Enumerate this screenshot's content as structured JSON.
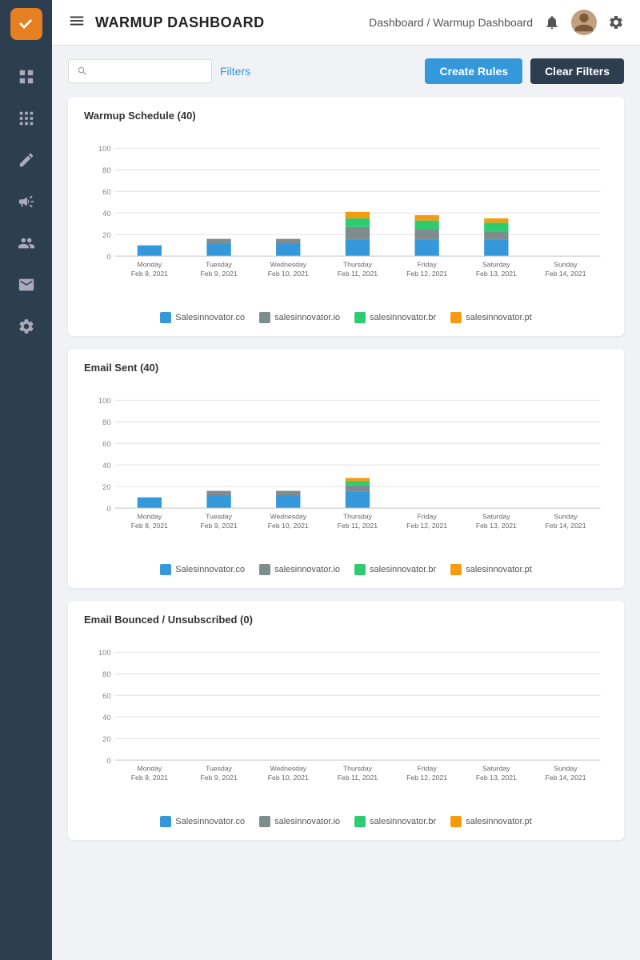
{
  "sidebar": {
    "logo_alt": "logo",
    "items": [
      {
        "name": "dashboard-icon",
        "label": "Dashboard"
      },
      {
        "name": "grid-icon",
        "label": "Grid"
      },
      {
        "name": "edit-icon",
        "label": "Edit"
      },
      {
        "name": "megaphone-icon",
        "label": "Campaigns"
      },
      {
        "name": "users-icon",
        "label": "Users"
      },
      {
        "name": "mail-icon",
        "label": "Mail"
      },
      {
        "name": "settings-icon",
        "label": "Settings"
      }
    ]
  },
  "topbar": {
    "hamburger_label": "menu",
    "title": "WARMUP DASHBOARD",
    "breadcrumb": "Dashboard / Warmup Dashboard",
    "notification_icon": "bell-icon",
    "avatar_icon": "avatar-icon",
    "settings_icon": "settings-icon"
  },
  "filters": {
    "search_placeholder": "",
    "filter_label": "Filters",
    "create_rules_label": "Create Rules",
    "clear_filters_label": "Clear Filters"
  },
  "charts": [
    {
      "id": "warmup-schedule",
      "title": "Warmup Schedule (40)",
      "x_labels": [
        "Monday\nFeb 8, 2021",
        "Tuesday\nFeb 9, 2021",
        "Wednesday\nFeb 10, 2021",
        "Thursday\nFeb 11, 2021",
        "Friday\nFeb 12, 2021",
        "Saturday\nFeb 13, 2021",
        "Sunday\nFeb 14, 2021"
      ],
      "y_max": 100,
      "y_ticks": [
        0,
        20,
        40,
        60,
        80,
        100
      ],
      "series": [
        {
          "name": "Salesinnovator.co",
          "color": "#3498db",
          "values": [
            10,
            12,
            12,
            15,
            15,
            15,
            0
          ]
        },
        {
          "name": "salesinnovator.io",
          "color": "#7f8c8d",
          "values": [
            0,
            4,
            4,
            12,
            10,
            8,
            0
          ]
        },
        {
          "name": "salesinnovator.br",
          "color": "#2ecc71",
          "values": [
            0,
            0,
            0,
            8,
            8,
            8,
            0
          ]
        },
        {
          "name": "salesinnovator.pt",
          "color": "#f39c12",
          "values": [
            0,
            0,
            0,
            6,
            5,
            4,
            0
          ]
        }
      ]
    },
    {
      "id": "email-sent",
      "title": "Email Sent (40)",
      "x_labels": [
        "Monday\nFeb 8, 2021",
        "Tuesday\nFeb 9, 2021",
        "Wednesday\nFeb 10, 2021",
        "Thursday\nFeb 11, 2021",
        "Friday\nFeb 12, 2021",
        "Saturday\nFeb 13, 2021",
        "Sunday\nFeb 14, 2021"
      ],
      "y_max": 100,
      "y_ticks": [
        0,
        20,
        40,
        60,
        80,
        100
      ],
      "series": [
        {
          "name": "Salesinnovator.co",
          "color": "#3498db",
          "values": [
            10,
            12,
            12,
            15,
            0,
            0,
            0
          ]
        },
        {
          "name": "salesinnovator.io",
          "color": "#7f8c8d",
          "values": [
            0,
            4,
            4,
            6,
            0,
            0,
            0
          ]
        },
        {
          "name": "salesinnovator.br",
          "color": "#2ecc71",
          "values": [
            0,
            0,
            0,
            4,
            0,
            0,
            0
          ]
        },
        {
          "name": "salesinnovator.pt",
          "color": "#f39c12",
          "values": [
            0,
            0,
            0,
            3,
            0,
            0,
            0
          ]
        }
      ]
    },
    {
      "id": "email-bounced",
      "title": "Email Bounced / Unsubscribed (0)",
      "x_labels": [
        "Monday\nFeb 8, 2021",
        "Tuesday\nFeb 9, 2021",
        "Wednesday\nFeb 10, 2021",
        "Thursday\nFeb 11, 2021",
        "Friday\nFeb 12, 2021",
        "Saturday\nFeb 13, 2021",
        "Sunday\nFeb 14, 2021"
      ],
      "y_max": 100,
      "y_ticks": [
        0,
        20,
        40,
        60,
        80,
        100
      ],
      "series": [
        {
          "name": "Salesinnovator.co",
          "color": "#3498db",
          "values": [
            0,
            0,
            0,
            0,
            0,
            0,
            0
          ]
        },
        {
          "name": "salesinnovator.io",
          "color": "#7f8c8d",
          "values": [
            0,
            0,
            0,
            0,
            0,
            0,
            0
          ]
        },
        {
          "name": "salesinnovator.br",
          "color": "#2ecc71",
          "values": [
            0,
            0,
            0,
            0,
            0,
            0,
            0
          ]
        },
        {
          "name": "salesinnovator.pt",
          "color": "#f39c12",
          "values": [
            0,
            0,
            0,
            0,
            0,
            0,
            0
          ]
        }
      ]
    }
  ],
  "legend": {
    "items": [
      {
        "name": "Salesinnovator.co",
        "color": "#3498db"
      },
      {
        "name": "salesinnovator.io",
        "color": "#7f8c8d"
      },
      {
        "name": "salesinnovator.br",
        "color": "#2ecc71"
      },
      {
        "name": "salesinnovator.pt",
        "color": "#f39c12"
      }
    ]
  }
}
